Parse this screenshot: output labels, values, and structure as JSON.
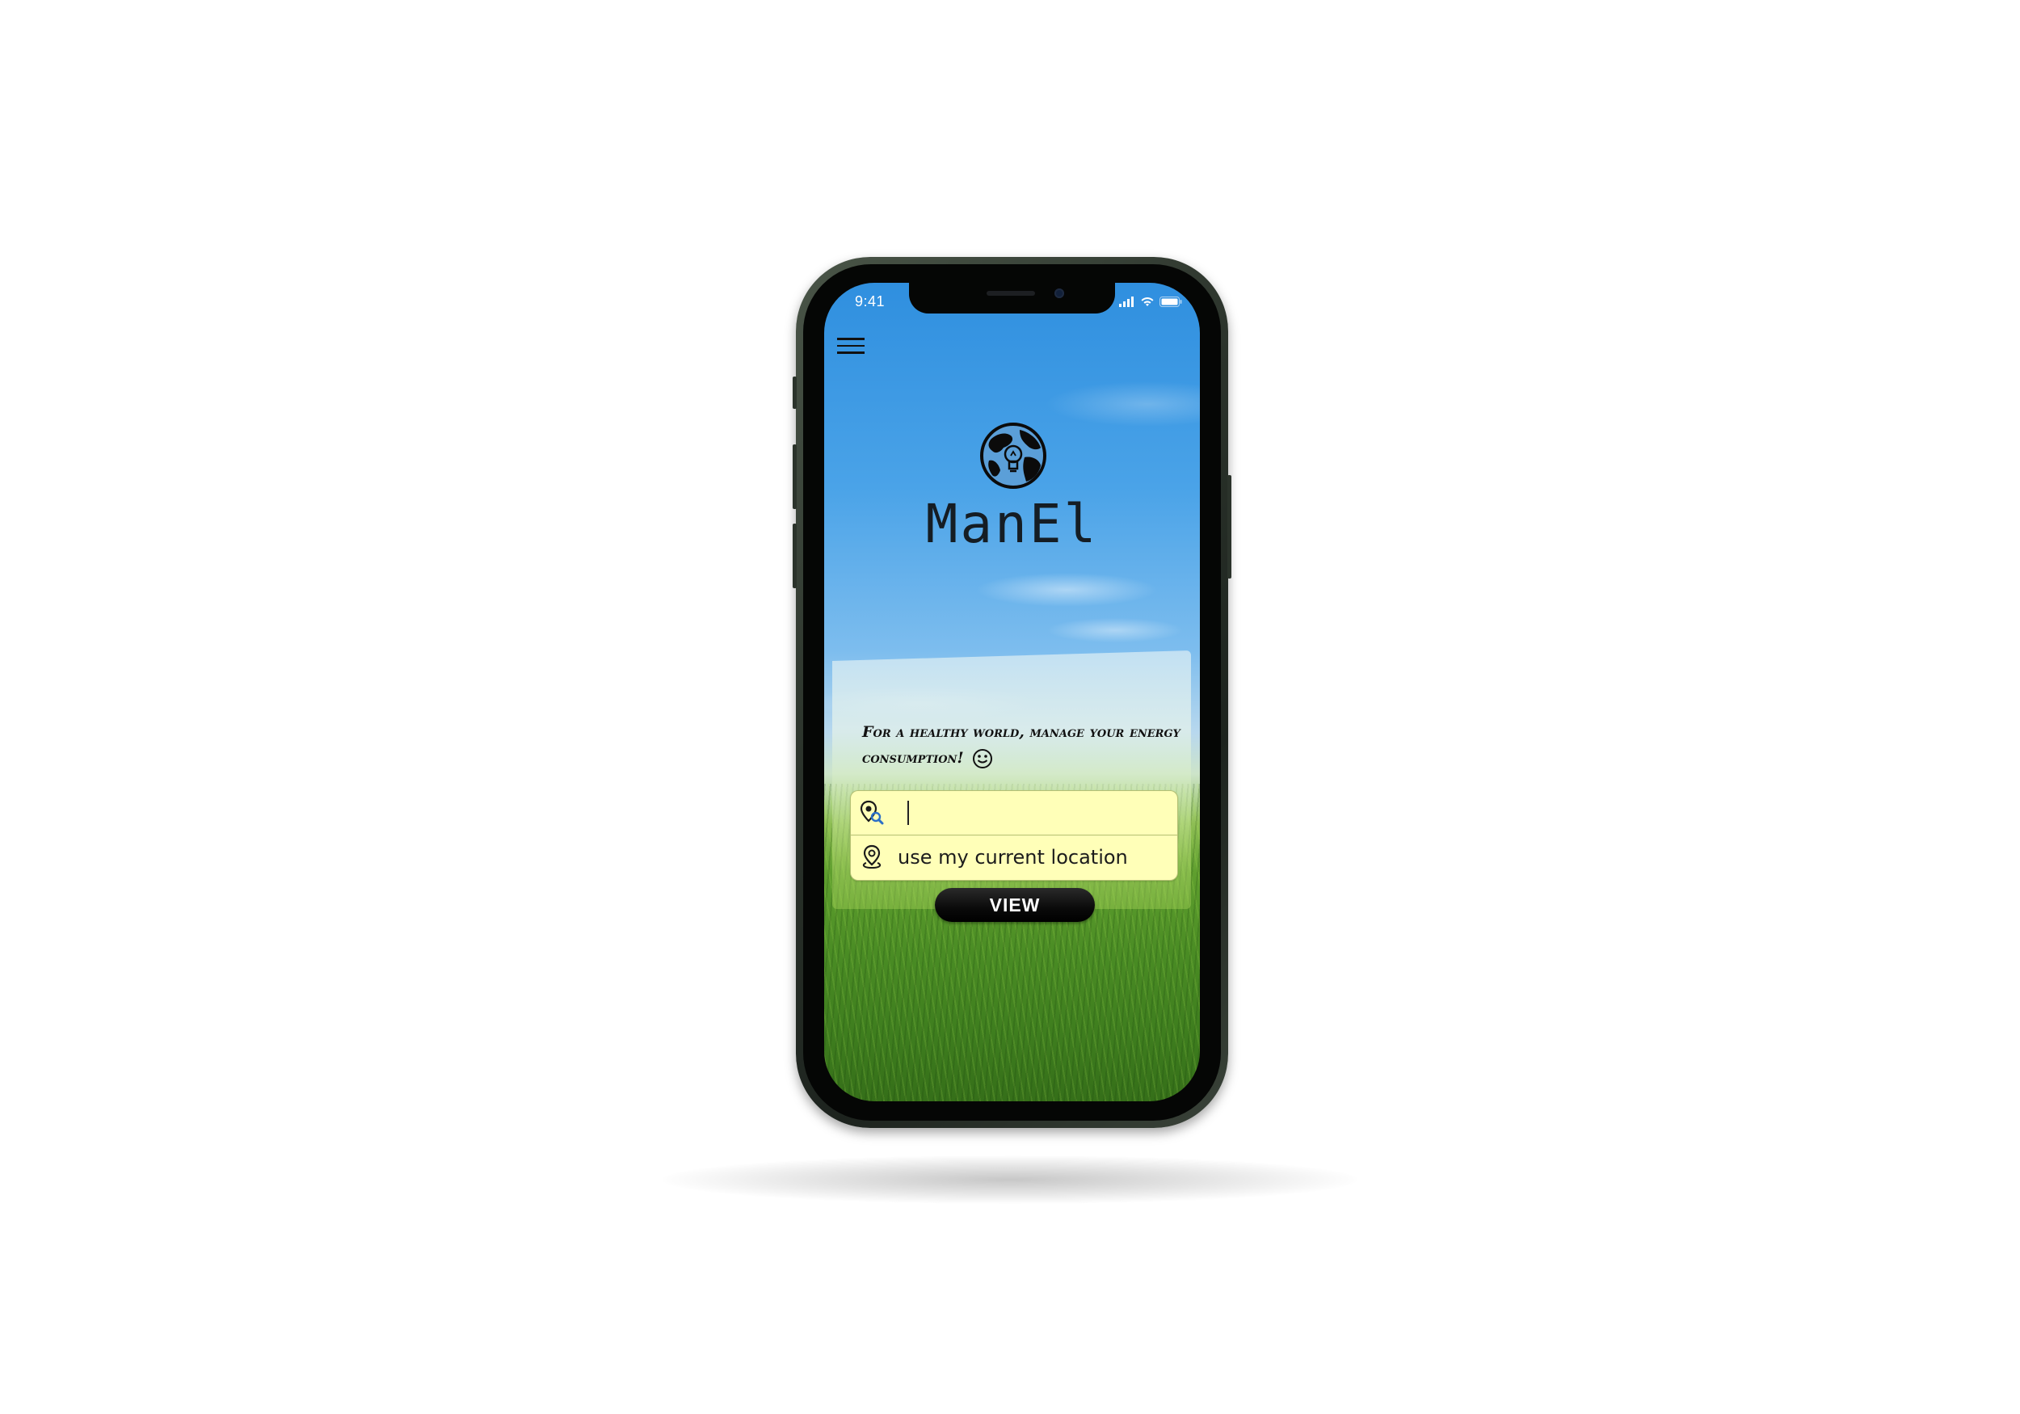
{
  "status_bar": {
    "time": "9:41"
  },
  "app": {
    "brand_name": "ManEl",
    "tagline": "For a healthy world, manage your energy consumption!"
  },
  "search": {
    "value": "",
    "placeholder": ""
  },
  "location": {
    "label": "use my current location"
  },
  "actions": {
    "view_label": "VIEW"
  },
  "colors": {
    "sky_top": "#2f8fdf",
    "grass": "#4a8c24",
    "search_field_bg": "#ffffb8",
    "button_bg": "#0a0a0a",
    "phone_frame": "#2b332b"
  },
  "icons": {
    "menu": "hamburger-menu-icon",
    "logo": "globe-lightbulb-icon",
    "search": "map-pin-search-icon",
    "location": "location-pin-icon",
    "tagline_emoji": "smiley-face-icon"
  }
}
